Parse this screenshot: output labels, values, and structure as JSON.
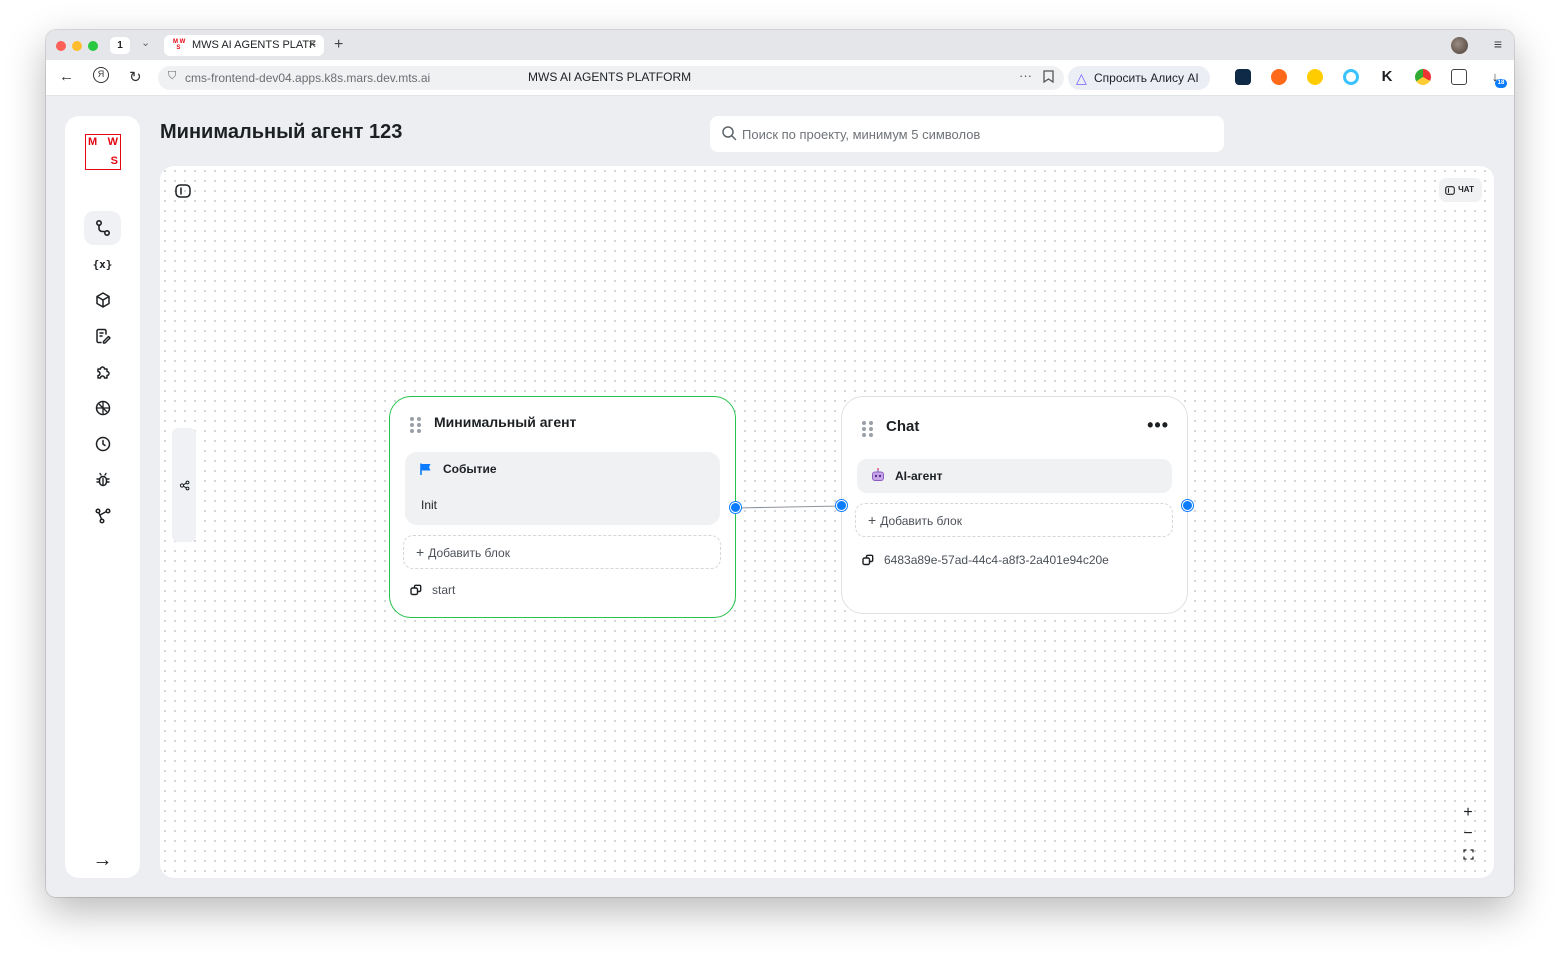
{
  "browser": {
    "tab_count": "1",
    "tab_title": "MWS AI AGENTS PLATF",
    "url": "cms-frontend-dev04.apps.k8s.mars.dev.mts.ai",
    "page_title": "MWS AI AGENTS PLATFORM",
    "alisa_label": "Спросить Алису AI",
    "download_badge": "18"
  },
  "app": {
    "logo_letters": [
      "M",
      "W",
      "S"
    ],
    "title": "Минимальный агент 123",
    "search": {
      "placeholder": "Поиск по проекту, минимум 5 символов"
    },
    "chat_button": "ЧАТ",
    "sidebar_icons": [
      "flow-icon",
      "variables-icon",
      "box-icon",
      "prompt-edit-icon",
      "plugin-icon",
      "globe-icon",
      "clock-icon",
      "bug-icon",
      "branch-icon"
    ]
  },
  "nodes": [
    {
      "title": "Минимальный агент",
      "event_label": "Событие",
      "event_value": "Init",
      "add_block": "Добавить блок",
      "footer": "start"
    },
    {
      "title": "Chat",
      "agent_label": "AI-агент",
      "add_block": "Добавить блок",
      "footer": "6483a89e-57ad-44c4-a8f3-2a401e94c20e"
    }
  ],
  "colors": {
    "brand_red": "#e30611",
    "active_node_border": "#27c24c",
    "port_blue": "#0b7cff"
  }
}
